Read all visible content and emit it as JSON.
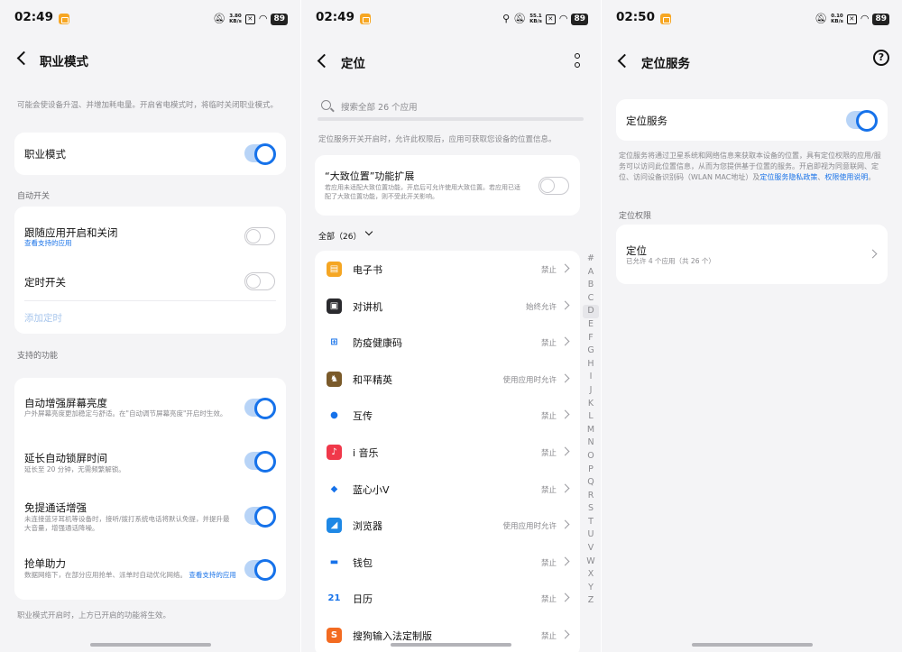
{
  "colors": {
    "accent": "#1672ea",
    "toggle_track_on": "#b8d4f7",
    "background": "#f4f4f6"
  },
  "screen1": {
    "status": {
      "time": "02:49",
      "speed_value": "3.80",
      "speed_unit": "KB/s",
      "battery": "89"
    },
    "title": "职业模式",
    "intro": "可能会使设备升温、并增加耗电量。开启省电模式时，将临时关闭职业模式。",
    "main_toggle": {
      "label": "职业模式",
      "on": true
    },
    "section_auto": "自动开关",
    "follow_app": {
      "label": "跟随应用开启和关闭",
      "link": "查看支持的应用",
      "on": false
    },
    "timer": {
      "label": "定时开关",
      "on": false
    },
    "add_timer": "添加定时",
    "section_features": "支持的功能",
    "features": [
      {
        "title": "自动增强屏幕亮度",
        "desc": "户外屏幕亮度更加稳定与舒适。在\"自动调节屏幕亮度\"开启时生效。",
        "on": true
      },
      {
        "title": "延长自动锁屏时间",
        "desc": "延长至 20 分钟，无需频繁解锁。",
        "on": true
      },
      {
        "title": "免提通话增强",
        "desc": "未连接蓝牙耳机等设备时，接听/拨打系统电话将默认免提，并提升最大音量，增强通话降噪。",
        "on": true
      },
      {
        "title": "抢单助力",
        "desc": "数据网络下，在部分应用抢单、派单时自动优化网络。",
        "link": "查看支持的应用",
        "on": true
      }
    ],
    "footer": "职业模式开启时，上方已开启的功能将生效。"
  },
  "screen2": {
    "status": {
      "time": "02:49",
      "speed_value": "55.1",
      "speed_unit": "KB/s",
      "battery": "89"
    },
    "title": "定位",
    "search_placeholder": "搜索全部 26 个应用",
    "intro": "定位服务开关开启时，允许此权限后，应用可获取您设备的位置信息。",
    "approx": {
      "title": "“大致位置”功能扩展",
      "desc": "若应用未适配大致位置功能，开启后可允许使用大致位置。若应用已适配了大致位置功能，则不受此开关影响。",
      "on": false
    },
    "filter": "全部（26）",
    "apps": [
      {
        "name": "电子书",
        "status": "禁止",
        "icon": "ebook-icon",
        "color": "#f5a623",
        "glyph": "▤"
      },
      {
        "name": "对讲机",
        "status": "始终允许",
        "icon": "walkie-talkie-icon",
        "color": "#2a2a2e",
        "glyph": "▣"
      },
      {
        "name": "防疫健康码",
        "status": "禁止",
        "icon": "health-code-icon",
        "color": "#ffffff",
        "glyph": "⊞"
      },
      {
        "name": "和平精英",
        "status": "使用应用时允许",
        "icon": "game-icon",
        "color": "#7a5a2a",
        "glyph": "♞"
      },
      {
        "name": "互传",
        "status": "禁止",
        "icon": "share-icon",
        "color": "#ffffff",
        "glyph": "●"
      },
      {
        "name": "i 音乐",
        "status": "禁止",
        "icon": "music-icon",
        "color": "#f0384a",
        "glyph": "♪"
      },
      {
        "name": "蓝心小V",
        "status": "禁止",
        "icon": "assistant-icon",
        "color": "#ffffff",
        "glyph": "◆"
      },
      {
        "name": "浏览器",
        "status": "使用应用时允许",
        "icon": "browser-icon",
        "color": "#1e88e5",
        "glyph": "◢"
      },
      {
        "name": "钱包",
        "status": "禁止",
        "icon": "wallet-icon",
        "color": "#ffffff",
        "glyph": "▬"
      },
      {
        "name": "日历",
        "status": "禁止",
        "icon": "calendar-icon",
        "color": "#ffffff",
        "glyph": "21"
      },
      {
        "name": "搜狗输入法定制版",
        "status": "禁止",
        "icon": "sogou-icon",
        "color": "#f36b21",
        "glyph": "S"
      }
    ],
    "alphabet": [
      "#",
      "A",
      "B",
      "C",
      "D",
      "E",
      "F",
      "G",
      "H",
      "I",
      "J",
      "K",
      "L",
      "M",
      "N",
      "O",
      "P",
      "Q",
      "R",
      "S",
      "T",
      "U",
      "V",
      "W",
      "X",
      "Y",
      "Z"
    ],
    "alphabet_active": "D"
  },
  "screen3": {
    "status": {
      "time": "02:50",
      "speed_value": "0.10",
      "speed_unit": "KB/s",
      "battery": "89"
    },
    "title": "定位服务",
    "service": {
      "label": "定位服务",
      "on": true
    },
    "desc_prefix": "定位服务将通过卫星系统和网络信息来获取本设备的位置，具有定位权限的应用/服务可以访问此位置信息，从而为您提供基于位置的服务。开启即视为同意联网、定位、访问设备识别码（WLAN MAC地址）及",
    "desc_link1": "定位服务隐私政策",
    "desc_sep": "、",
    "desc_link2": "权限使用说明",
    "desc_suffix": "。",
    "section": "定位权限",
    "perm": {
      "label": "定位",
      "sub": "已允许 4 个应用（共 26 个）"
    }
  }
}
